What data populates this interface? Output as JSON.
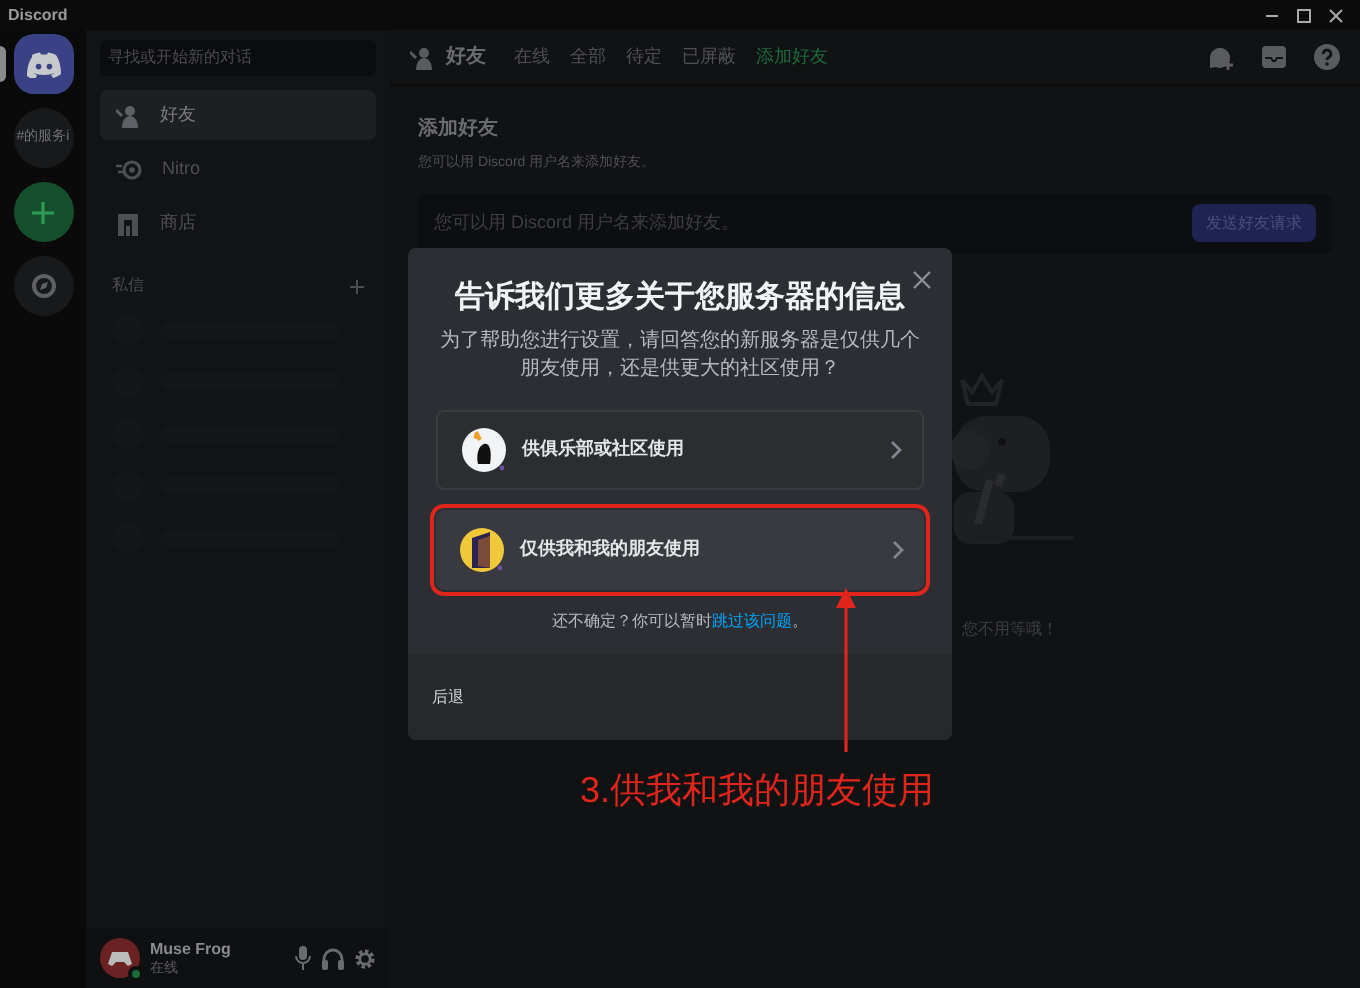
{
  "window": {
    "title": "Discord"
  },
  "servers": [
    {
      "kind": "home",
      "selected": true
    },
    {
      "kind": "text",
      "label": "#的服务i",
      "selected": false
    },
    {
      "kind": "add",
      "selected": false
    },
    {
      "kind": "explore",
      "selected": false
    }
  ],
  "sidebar": {
    "search": {
      "placeholder": "寻找或开始新的对话"
    },
    "items": [
      {
        "kind": "friends",
        "label": "好友",
        "selected": true
      },
      {
        "kind": "nitro",
        "label": "Nitro",
        "selected": false
      },
      {
        "kind": "shop",
        "label": "商店",
        "selected": false
      }
    ],
    "dm_header": "私信"
  },
  "user": {
    "name": "Muse Frog",
    "status": "在线"
  },
  "header": {
    "title": "好友",
    "tabs": [
      {
        "label": "在线",
        "selected": false
      },
      {
        "label": "全部",
        "selected": false
      },
      {
        "label": "待定",
        "selected": false
      },
      {
        "label": "已屏蔽",
        "selected": false
      },
      {
        "label": "添加好友",
        "selected": true
      }
    ]
  },
  "add_friend": {
    "title": "添加好友",
    "description": "您可以用 Discord 用户名来添加好友。",
    "input": {
      "placeholder": "您可以用 Discord 用户名来添加好友。"
    },
    "button": "发送好友请求"
  },
  "empty_state": {
    "text": "您不用等哦！"
  },
  "modal": {
    "title": "告诉我们更多关于您服务器的信息",
    "description": "为了帮助您进行设置，请回答您的新服务器是仅供几个朋友使用，还是供更大的社区使用？",
    "options": [
      {
        "kind": "community",
        "label": "供俱乐部或社区使用",
        "annotated": false
      },
      {
        "kind": "friends",
        "label": "仅供我和我的朋友使用",
        "annotated": true
      }
    ],
    "skip_text": "还不确定？你可以暂时",
    "skip_link": "跳过该问题",
    "skip_end": "。",
    "back": "后退"
  },
  "annotation": {
    "text": "3.供我和我的朋友使用"
  }
}
